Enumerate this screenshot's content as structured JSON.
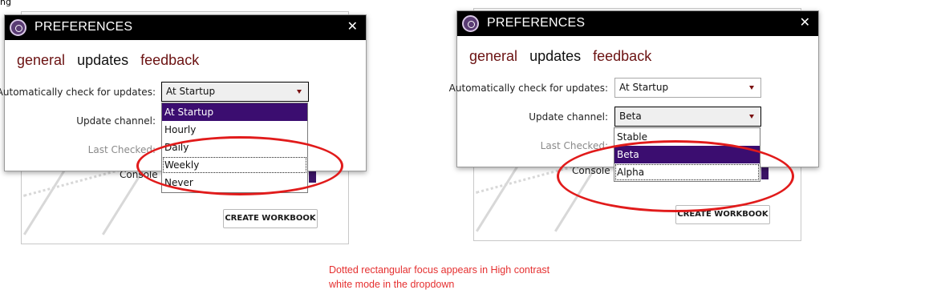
{
  "corner_text": "ng",
  "panels": [
    {
      "title": "PREFERENCES",
      "close": "✕",
      "tabs": [
        "general",
        "updates",
        "feedback"
      ],
      "active_tab": "updates",
      "check_label": "Automatically check for updates:",
      "check_value": "At Startup",
      "channel_label": "Update channel:",
      "last_checked_label": "Last Checked:",
      "console_label": "Console",
      "create_workbook": "CREATE WORKBOOK",
      "dropdown_options": [
        "At Startup",
        "Hourly",
        "Daily",
        "Weekly",
        "Never"
      ],
      "selected_option": "At Startup",
      "focused_option": "Weekly"
    },
    {
      "title": "PREFERENCES",
      "close": "✕",
      "tabs": [
        "general",
        "updates",
        "feedback"
      ],
      "active_tab": "updates",
      "check_label": "Automatically check for updates:",
      "check_value": "At Startup",
      "channel_label": "Update channel:",
      "channel_value": "Beta",
      "last_checked_label": "Last Checked:",
      "console_label": "Console",
      "create_workbook": "CREATE WORKBOOK",
      "dropdown_options": [
        "Stable",
        "Beta",
        "Alpha"
      ],
      "selected_option": "Beta",
      "focused_option": "Alpha"
    }
  ],
  "caption_lines": [
    "Dotted rectangular focus appears in High contrast",
    "white mode in the dropdown"
  ],
  "colors": {
    "annotation": "#e11b1b",
    "selection": "#3b0d70",
    "tab_link": "#6b1212",
    "titlebar": "#000000"
  }
}
